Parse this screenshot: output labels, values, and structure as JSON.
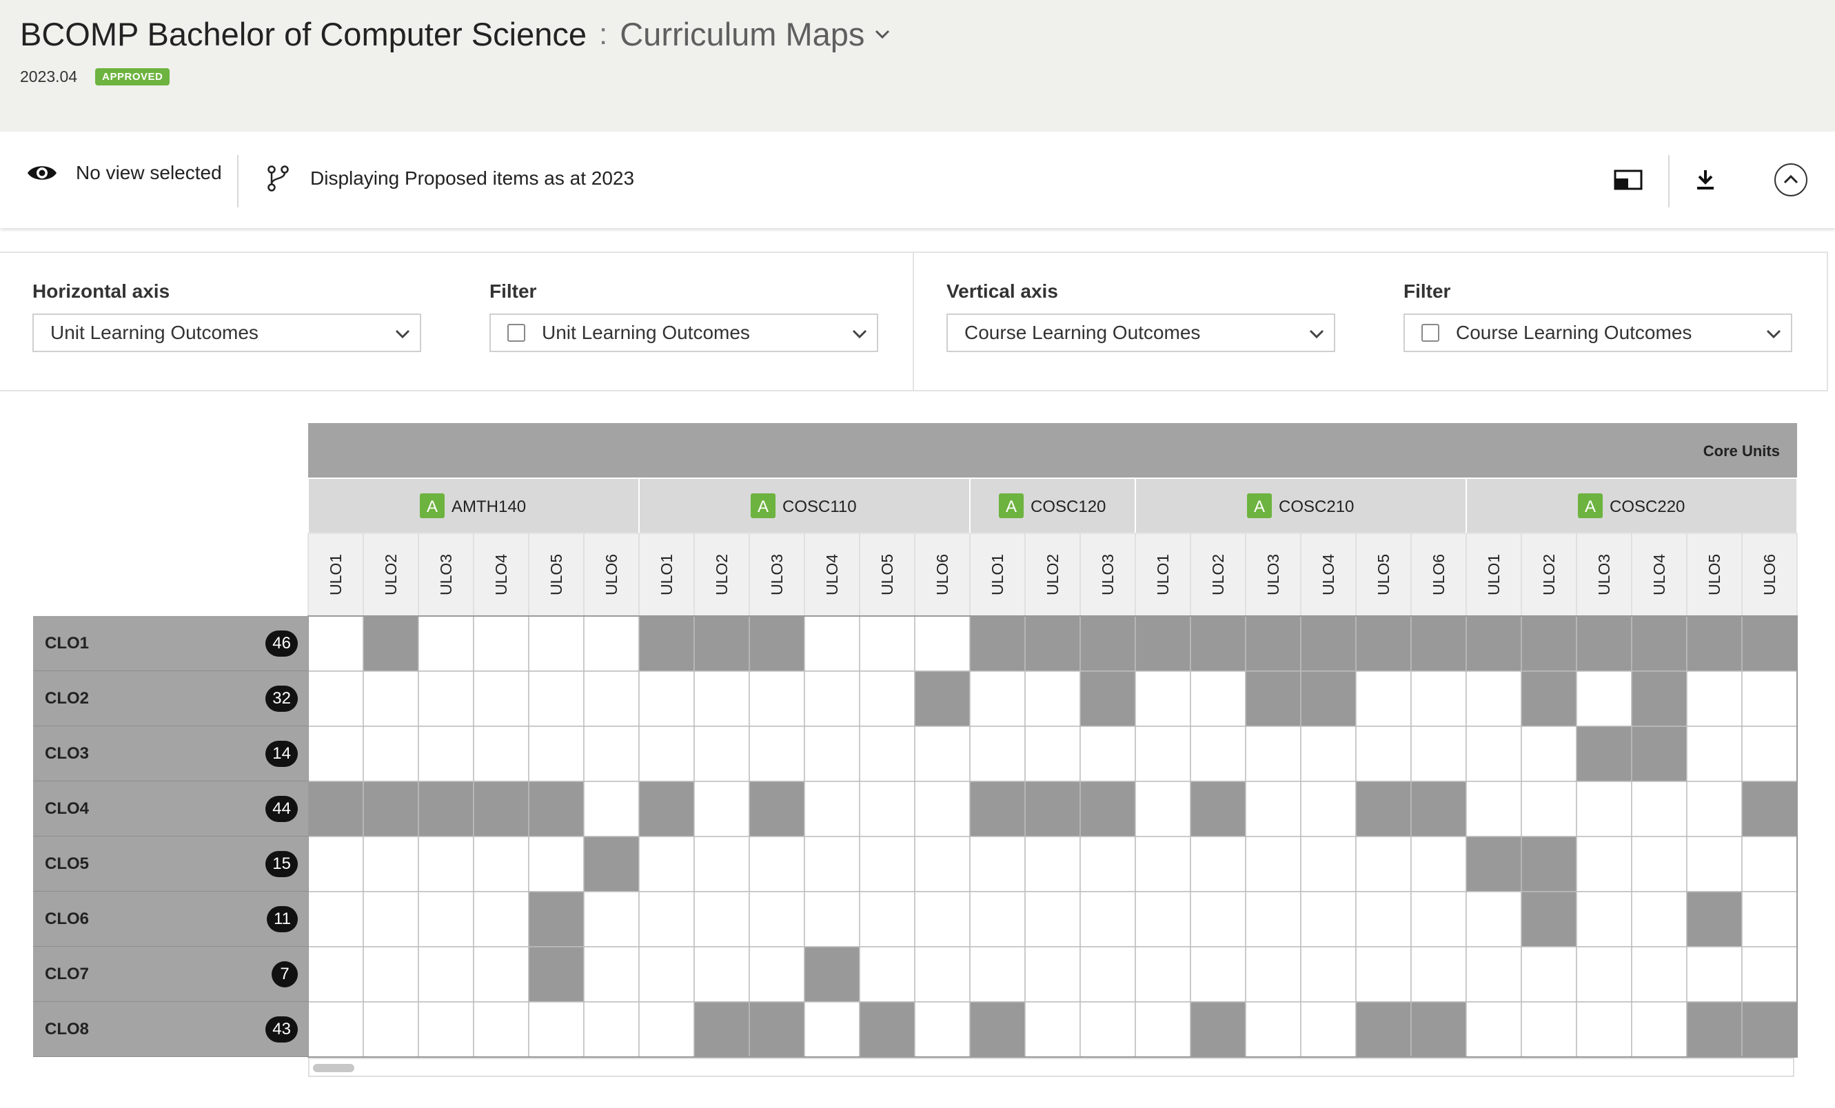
{
  "header": {
    "title": "BCOMP Bachelor of Computer Science",
    "separator": ":",
    "subtitle": "Curriculum Maps",
    "version": "2023.04",
    "status_badge": "APPROVED"
  },
  "toolbar": {
    "view_label": "No view selected",
    "display_label": "Displaying Proposed items as at 2023",
    "icons": [
      "eye-icon",
      "branch-icon",
      "cast-icon",
      "download-icon",
      "collapse-up-icon"
    ]
  },
  "axes": {
    "horizontal": {
      "label": "Horizontal axis",
      "value": "Unit Learning Outcomes"
    },
    "horizontal_filter": {
      "label": "Filter",
      "value": "Unit Learning Outcomes"
    },
    "vertical": {
      "label": "Vertical axis",
      "value": "Course Learning Outcomes"
    },
    "vertical_filter": {
      "label": "Filter",
      "value": "Course Learning Outcomes"
    }
  },
  "matrix": {
    "group_title": "Core Units",
    "units": [
      {
        "badge": "A",
        "code": "AMTH140",
        "ulos": [
          "ULO1",
          "ULO2",
          "ULO3",
          "ULO4",
          "ULO5",
          "ULO6"
        ]
      },
      {
        "badge": "A",
        "code": "COSC110",
        "ulos": [
          "ULO1",
          "ULO2",
          "ULO3",
          "ULO4",
          "ULO5",
          "ULO6"
        ]
      },
      {
        "badge": "A",
        "code": "COSC120",
        "ulos": [
          "ULO1",
          "ULO2",
          "ULO3"
        ]
      },
      {
        "badge": "A",
        "code": "COSC210",
        "ulos": [
          "ULO1",
          "ULO2",
          "ULO3",
          "ULO4",
          "ULO5",
          "ULO6"
        ]
      },
      {
        "badge": "A",
        "code": "COSC220",
        "ulos": [
          "ULO1",
          "ULO2",
          "ULO3",
          "ULO4",
          "ULO5",
          "ULO6"
        ]
      }
    ],
    "rows": [
      {
        "label": "CLO1",
        "count": "46",
        "cells": [
          0,
          1,
          0,
          0,
          0,
          0,
          1,
          1,
          1,
          0,
          0,
          0,
          1,
          1,
          1,
          1,
          1,
          1,
          1,
          1,
          1,
          1,
          1,
          1,
          1,
          1,
          1
        ]
      },
      {
        "label": "CLO2",
        "count": "32",
        "cells": [
          0,
          0,
          0,
          0,
          0,
          0,
          0,
          0,
          0,
          0,
          0,
          1,
          0,
          0,
          1,
          0,
          0,
          1,
          1,
          0,
          0,
          0,
          1,
          0,
          1,
          0,
          0
        ]
      },
      {
        "label": "CLO3",
        "count": "14",
        "cells": [
          0,
          0,
          0,
          0,
          0,
          0,
          0,
          0,
          0,
          0,
          0,
          0,
          0,
          0,
          0,
          0,
          0,
          0,
          0,
          0,
          0,
          0,
          0,
          1,
          1,
          0,
          0
        ]
      },
      {
        "label": "CLO4",
        "count": "44",
        "cells": [
          1,
          1,
          1,
          1,
          1,
          0,
          1,
          0,
          1,
          0,
          0,
          0,
          1,
          1,
          1,
          0,
          1,
          0,
          0,
          1,
          1,
          0,
          0,
          0,
          0,
          0,
          1
        ]
      },
      {
        "label": "CLO5",
        "count": "15",
        "cells": [
          0,
          0,
          0,
          0,
          0,
          1,
          0,
          0,
          0,
          0,
          0,
          0,
          0,
          0,
          0,
          0,
          0,
          0,
          0,
          0,
          0,
          1,
          1,
          0,
          0,
          0,
          0
        ]
      },
      {
        "label": "CLO6",
        "count": "11",
        "cells": [
          0,
          0,
          0,
          0,
          1,
          0,
          0,
          0,
          0,
          0,
          0,
          0,
          0,
          0,
          0,
          0,
          0,
          0,
          0,
          0,
          0,
          0,
          1,
          0,
          0,
          1,
          0
        ]
      },
      {
        "label": "CLO7",
        "count": "7",
        "cells": [
          0,
          0,
          0,
          0,
          1,
          0,
          0,
          0,
          0,
          1,
          0,
          0,
          0,
          0,
          0,
          0,
          0,
          0,
          0,
          0,
          0,
          0,
          0,
          0,
          0,
          0,
          0
        ]
      },
      {
        "label": "CLO8",
        "count": "43",
        "cells": [
          0,
          0,
          0,
          0,
          0,
          0,
          0,
          1,
          1,
          0,
          1,
          0,
          1,
          0,
          0,
          0,
          1,
          0,
          0,
          1,
          1,
          0,
          0,
          0,
          0,
          1,
          1
        ]
      }
    ]
  },
  "colors": {
    "header_bg": "#f0f0ec",
    "badge_green": "#6db33f",
    "mapped_cell": "#999999",
    "empty_cell": "#ffffff",
    "group_bar": "#a3a3a3",
    "unit_bar": "#d9d9d9",
    "ulo_bar": "#f0f0f0",
    "count_pill": "#111111"
  }
}
